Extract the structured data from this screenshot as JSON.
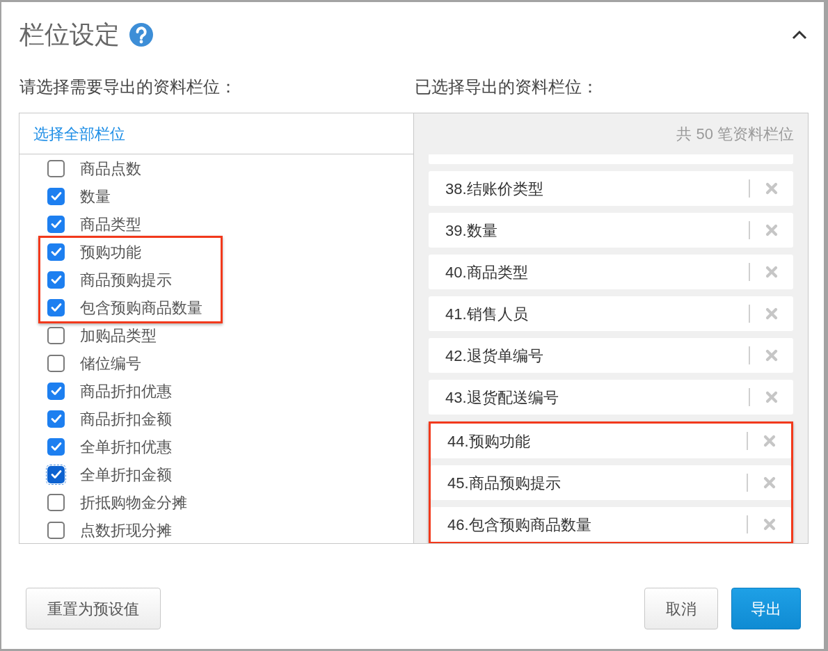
{
  "dialog": {
    "title": "栏位设定"
  },
  "left_panel": {
    "heading": "请选择需要导出的资料栏位：",
    "select_all_link": "选择全部栏位",
    "items": [
      {
        "label": "商品点数",
        "checked": false,
        "highlighted": false,
        "focused": false
      },
      {
        "label": "数量",
        "checked": true,
        "highlighted": false,
        "focused": false
      },
      {
        "label": "商品类型",
        "checked": true,
        "highlighted": false,
        "focused": false
      },
      {
        "label": "预购功能",
        "checked": true,
        "highlighted": true,
        "focused": false
      },
      {
        "label": "商品预购提示",
        "checked": true,
        "highlighted": true,
        "focused": false
      },
      {
        "label": "包含预购商品数量",
        "checked": true,
        "highlighted": true,
        "focused": false
      },
      {
        "label": "加购品类型",
        "checked": false,
        "highlighted": false,
        "focused": false
      },
      {
        "label": "储位编号",
        "checked": false,
        "highlighted": false,
        "focused": false
      },
      {
        "label": "商品折扣优惠",
        "checked": true,
        "highlighted": false,
        "focused": false
      },
      {
        "label": "商品折扣金额",
        "checked": true,
        "highlighted": false,
        "focused": false
      },
      {
        "label": "全单折扣优惠",
        "checked": true,
        "highlighted": false,
        "focused": false
      },
      {
        "label": "全单折扣金额",
        "checked": true,
        "highlighted": false,
        "focused": true
      },
      {
        "label": "折抵购物金分摊",
        "checked": false,
        "highlighted": false,
        "focused": false
      },
      {
        "label": "点数折现分摊",
        "checked": false,
        "highlighted": false,
        "focused": false
      }
    ]
  },
  "right_panel": {
    "heading": "已选择导出的资料栏位：",
    "count": "共 50 笔资料栏位",
    "items": [
      {
        "label": "38.结账价类型",
        "highlighted": false
      },
      {
        "label": "39.数量",
        "highlighted": false
      },
      {
        "label": "40.商品类型",
        "highlighted": false
      },
      {
        "label": "41.销售人员",
        "highlighted": false
      },
      {
        "label": "42.退货单编号",
        "highlighted": false
      },
      {
        "label": "43.退货配送编号",
        "highlighted": false
      },
      {
        "label": "44.预购功能",
        "highlighted": true
      },
      {
        "label": "45.商品预购提示",
        "highlighted": true
      },
      {
        "label": "46.包含预购商品数量",
        "highlighted": true
      }
    ]
  },
  "footer": {
    "left_buttons": [
      {
        "label": "重置为预设值",
        "kind": "default"
      }
    ],
    "right_buttons": [
      {
        "label": "取消",
        "kind": "default"
      },
      {
        "label": "导出",
        "kind": "primary"
      }
    ]
  }
}
